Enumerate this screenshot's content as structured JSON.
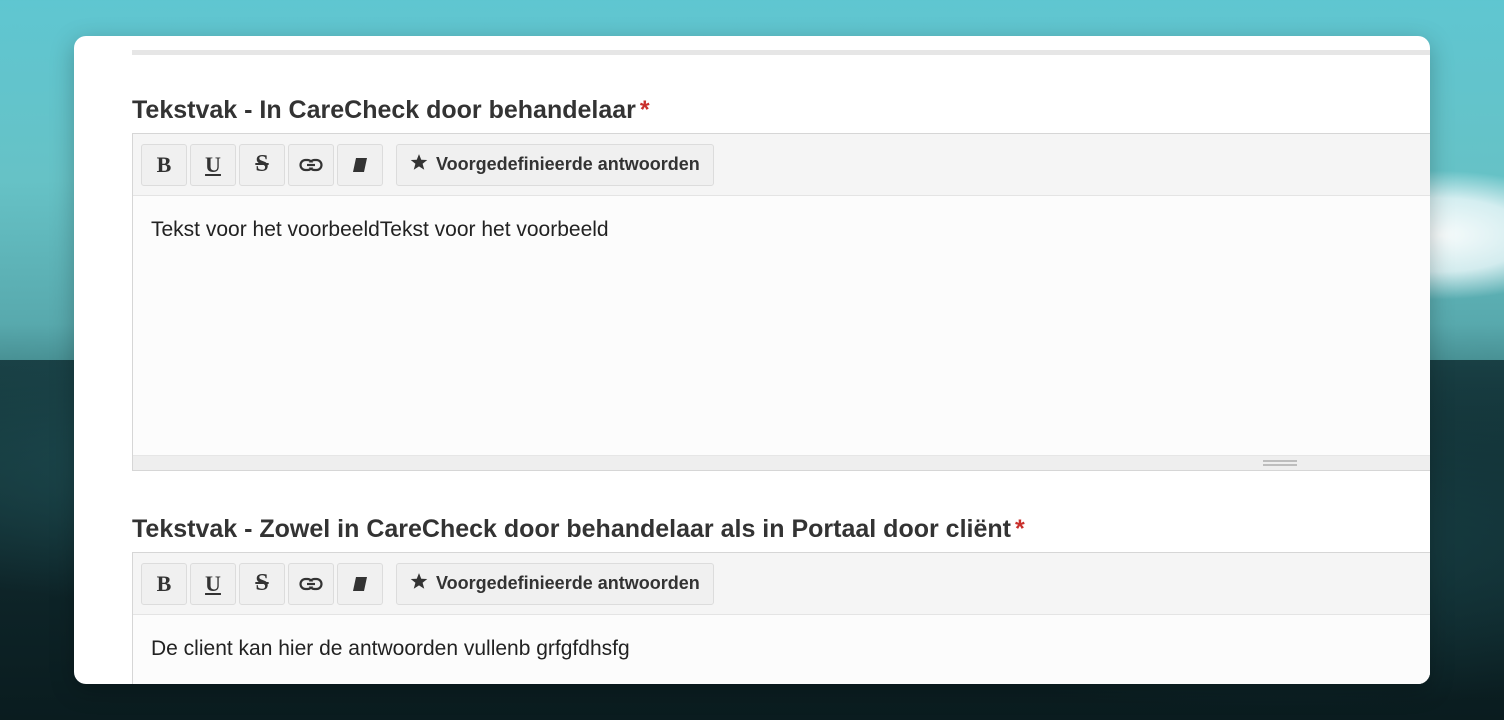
{
  "fields": [
    {
      "label": "Tekstvak - In CareCheck door behandelaar",
      "required_mark": "*",
      "toolbar": {
        "bold": "B",
        "underline": "U",
        "strike": "S",
        "link_icon": "link-icon",
        "eraser_icon": "eraser-icon",
        "predefined_icon": "star-icon",
        "predefined_label": "Voorgedefinieerde antwoorden"
      },
      "content": "Tekst voor het voorbeeldTekst voor het voorbeeld"
    },
    {
      "label": "Tekstvak - Zowel in CareCheck door behandelaar als in Portaal door cliënt",
      "required_mark": "*",
      "toolbar": {
        "bold": "B",
        "underline": "U",
        "strike": "S",
        "link_icon": "link-icon",
        "eraser_icon": "eraser-icon",
        "predefined_icon": "star-icon",
        "predefined_label": "Voorgedefinieerde antwoorden"
      },
      "content": "De client kan hier de antwoorden vullenb grfgfdhsfg"
    }
  ],
  "colors": {
    "required": "#c9302c",
    "label_text": "#333333",
    "toolbar_bg": "#f5f5f5"
  }
}
